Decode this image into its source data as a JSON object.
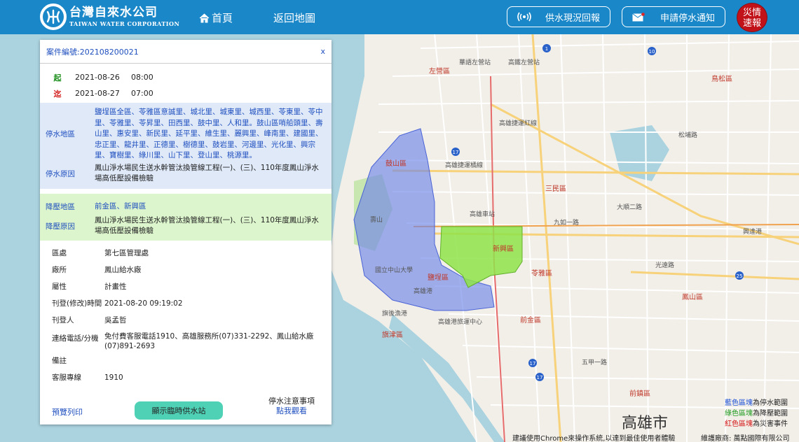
{
  "header": {
    "logo_zh": "台灣自來水公司",
    "logo_en": "TAIWAN WATER CORPORATION",
    "nav_home": "首頁",
    "nav_back": "返回地圖",
    "btn_report": "供水現況回報",
    "btn_notify": "申請停水通知",
    "disaster_line1": "災情",
    "disaster_line2": "速報"
  },
  "panel": {
    "case_no": "案件編號:202108200021",
    "close": "x",
    "start_label": "起",
    "start_date": "2021-08-26",
    "start_time": "08:00",
    "end_label": "迄",
    "end_date": "2021-08-27",
    "end_time": "07:00",
    "outage_area_label": "停水地區",
    "outage_area": "鹽埕區全區、苓雅區意誠里、城北里、城東里、城西里、苓東里、苓中里、苓雅里、苓昇里、田西里、鼓中里、人和里。鼓山區哨船頭里、壽山里、惠安里、新民里、延平里、維生里、麗興里、峰南里、建國里、忠正里、龍井里、正德里、樹德里、鼓岩里、河邊里、光化里、興宗里、寶樹里、綠川里、山下里、登山里、桃源里。",
    "outage_reason_label": "停水原因",
    "outage_reason": "鳳山淨水場民生送水幹管汰換管線工程(一)、(三)、110年度鳳山淨水場高低壓設備檢驗",
    "lowp_area_label": "降壓地區",
    "lowp_area": "前金區、新興區",
    "lowp_reason_label": "降壓原因",
    "lowp_reason": "鳳山淨水場民生送水幹管汰換管線工程(一)、(三)、110年度鳳山淨水場高低壓設備檢驗",
    "info": [
      {
        "k": "區處",
        "v": "第七區管理處"
      },
      {
        "k": "廠所",
        "v": "鳳山給水廠"
      },
      {
        "k": "屬性",
        "v": "計畫性"
      },
      {
        "k": "刊登(修改)時間",
        "v": "2021-08-20 09:19:02"
      },
      {
        "k": "刊登人",
        "v": "吳孟哲"
      },
      {
        "k": "連絡電話/分機",
        "v": "免付費客服電話1910、高雄服務所(07)331-2292、鳳山給水廠(07)891-2693"
      },
      {
        "k": "備註",
        "v": ""
      },
      {
        "k": "客服專線",
        "v": "1910"
      }
    ],
    "print_link": "預覽列印",
    "temp_station_btn": "顯示臨時供水站",
    "notice_title": "停水注意事項",
    "notice_link": "點我觀看"
  },
  "map": {
    "districts": [
      "左營區",
      "鼓山區",
      "三民區",
      "新興區",
      "苓雅區",
      "前金區",
      "鹽埕區",
      "鳳山區",
      "前鎮區",
      "鳥松區",
      "旗津區"
    ],
    "labels": [
      "華語左營站",
      "高鐵左營站",
      "高雄車站",
      "高雄捷運紅線",
      "高雄捷運橘線",
      "高雄港",
      "旗後漁港",
      "高雄港旅運中心",
      "九如一路",
      "大順二路",
      "五甲一路",
      "光遠路",
      "國立中山大學",
      "壽山",
      "松埔路",
      "興達港"
    ],
    "city": "高雄市",
    "legend": {
      "blue_key": "藍色區塊",
      "blue_val": "為停水範圍",
      "green_key": "綠色區塊",
      "green_val": "為降壓範圍",
      "red_key": "紅色區塊",
      "red_val": "為災害事件"
    },
    "footer_note": "建議使用Chrome來操作系統,以達到最佳使用者體驗",
    "footer_maint": "維護廠商: 萬點國際有限公司",
    "colors": {
      "header": "#1a87c8",
      "outage": "#6f86e8",
      "lowpressure": "#8fe34a"
    }
  }
}
